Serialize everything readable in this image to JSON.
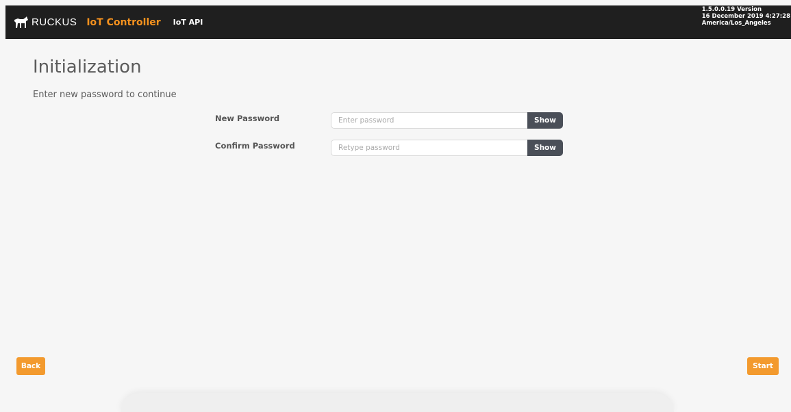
{
  "header": {
    "brand": "RUCKUS",
    "brand_mark_icon": "ruckus-dog-icon",
    "app_name": "IoT Controller",
    "nav_link": "IoT API",
    "version_line1": "1.5.0.0.19 Version",
    "version_line2": "16 December 2019 4:27:28",
    "version_line3": "America/Los_Angeles",
    "accent_color": "#f6921e"
  },
  "main": {
    "title": "Initialization",
    "subtitle": "Enter new password to continue",
    "fields": [
      {
        "label": "New Password",
        "placeholder": "Enter password",
        "value": "",
        "toggle_label": "Show"
      },
      {
        "label": "Confirm Password",
        "placeholder": "Retype password",
        "value": "",
        "toggle_label": "Show"
      }
    ]
  },
  "footer": {
    "back_label": "Back",
    "start_label": "Start",
    "button_color": "#f39a2e"
  }
}
